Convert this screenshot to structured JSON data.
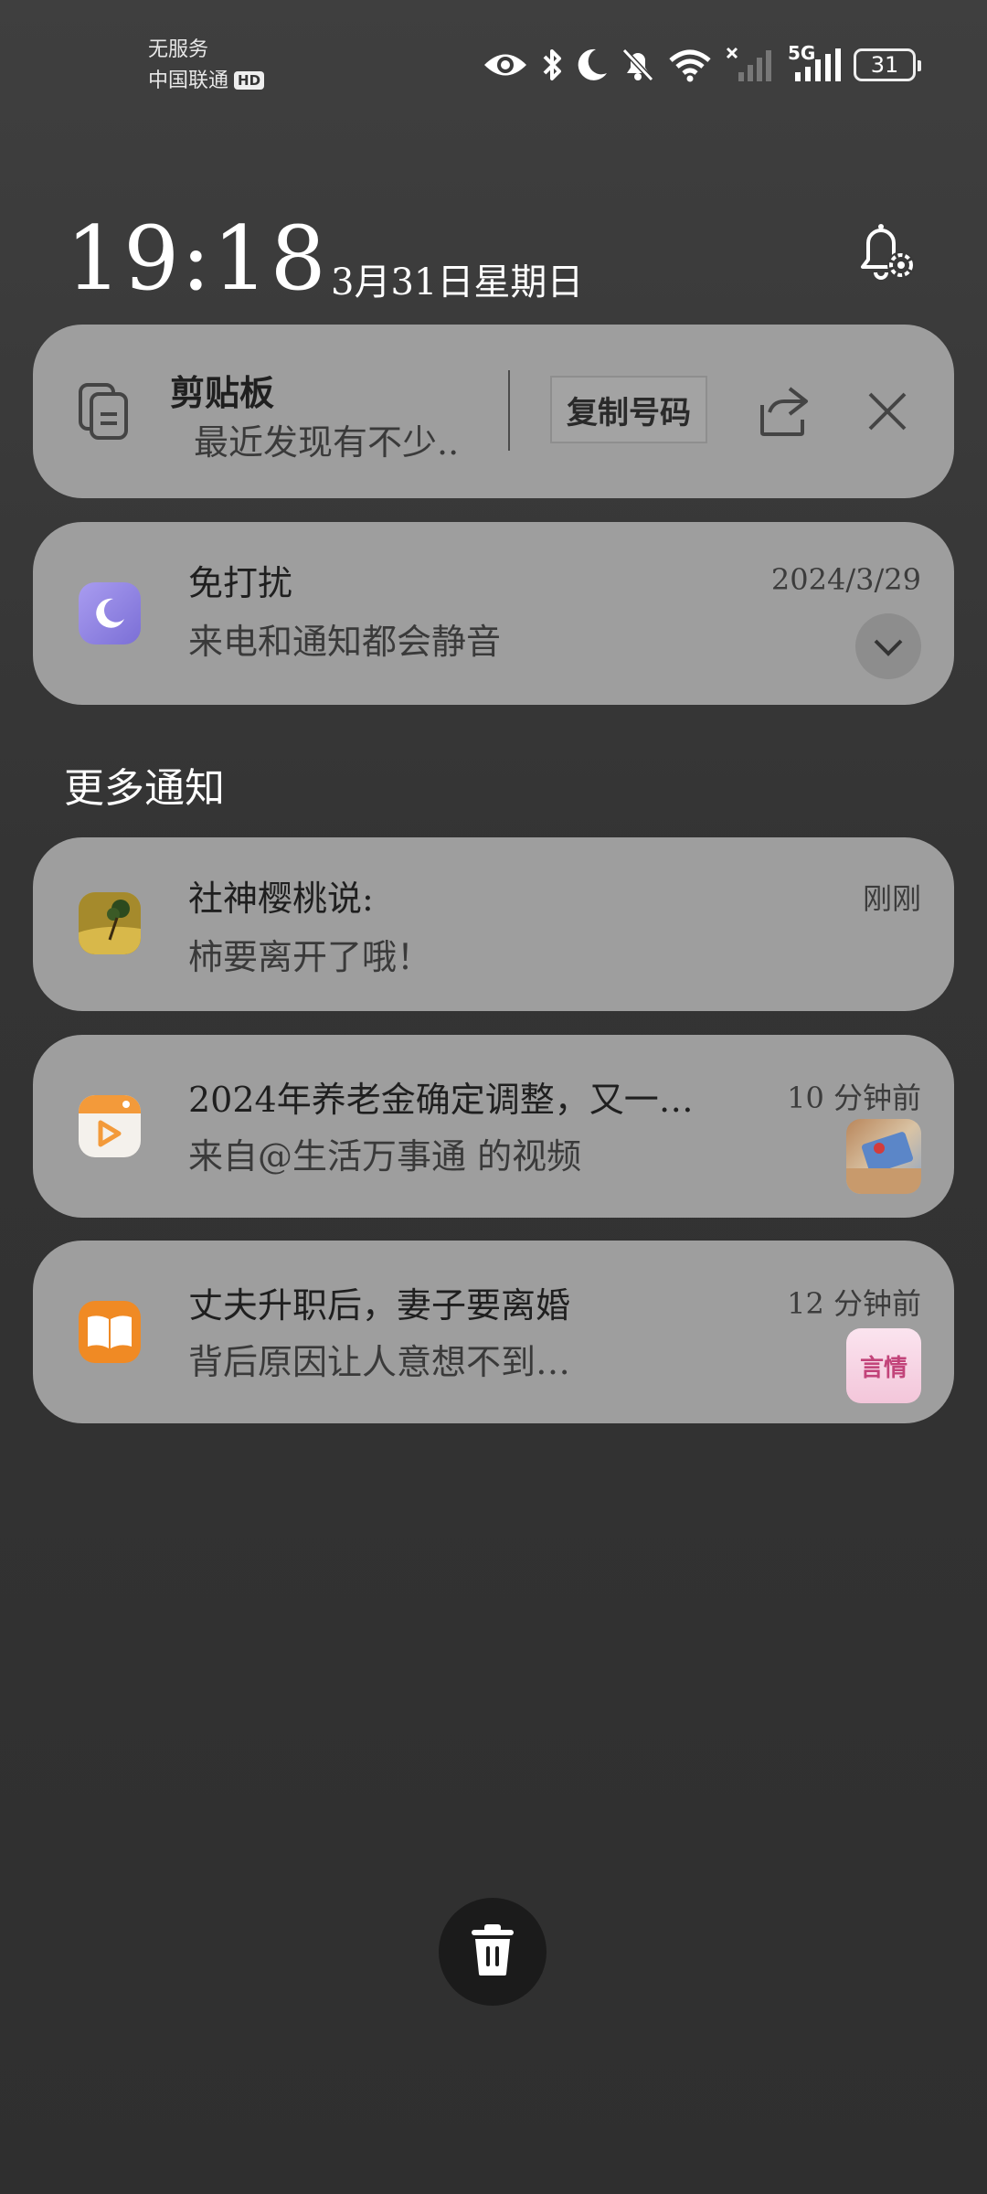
{
  "status_bar": {
    "carrier_line1": "无服务",
    "carrier_line2": "中国联通",
    "hd_badge": "HD",
    "network_label": "5G",
    "battery_level": "31"
  },
  "header": {
    "time": "19:18",
    "date": "3月31日星期日"
  },
  "clipboard": {
    "title": "剪贴板",
    "preview": "最近发现有不少..",
    "copy_button": "复制号码"
  },
  "dnd": {
    "title": "免打扰",
    "subtitle": "来电和通知都会静音",
    "time": "2024/3/29"
  },
  "more_section": {
    "title": "更多通知"
  },
  "notifications": [
    {
      "title": "社神樱桃说:",
      "subtitle": "柿要离开了哦！",
      "time": "刚刚"
    },
    {
      "title": "2024年养老金确定调整，又一…",
      "subtitle": "来自@生活万事通 的视频",
      "time": "10 分钟前"
    },
    {
      "title": "丈夫升职后，妻子要离婚",
      "subtitle": "背后原因让人意想不到…",
      "time": "12 分钟前",
      "thumb_text": "言情"
    }
  ],
  "colors": {
    "card_bg": "#9e9e9e",
    "dnd_icon": "#8b7fd9",
    "video_app_icon": "#f39a3a",
    "reader_app_icon": "#f08a24"
  },
  "icons": [
    "eye-icon",
    "bluetooth-icon",
    "moon-icon",
    "bell-off-icon",
    "wifi-icon",
    "no-signal-icon",
    "signal-icon",
    "battery-icon",
    "bell-settings-icon",
    "clipboard-icon",
    "share-icon",
    "close-icon",
    "chevron-down-icon",
    "trash-icon"
  ]
}
